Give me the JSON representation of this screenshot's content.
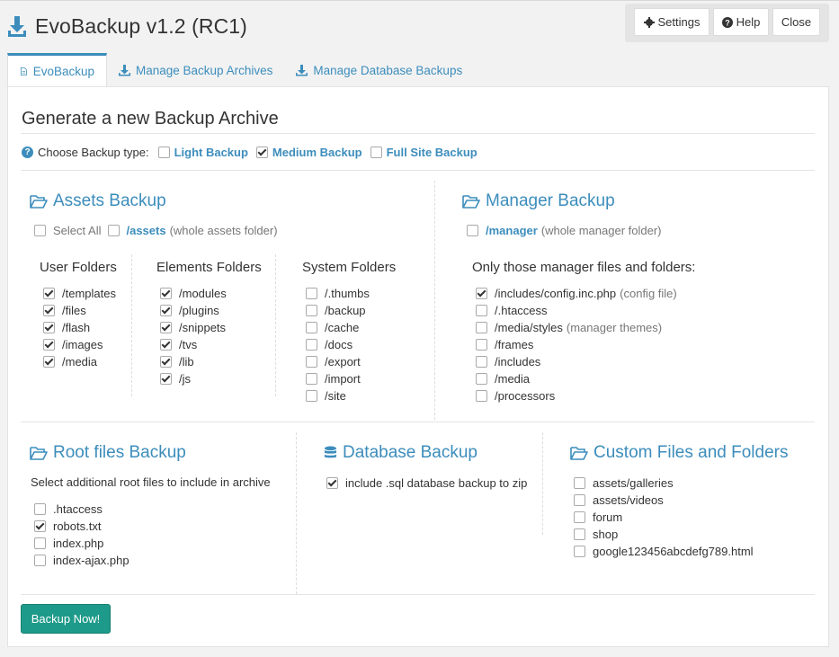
{
  "header": {
    "title": "EvoBackup v1.2 (RC1)",
    "settings_label": "Settings",
    "help_label": "Help",
    "close_label": "Close"
  },
  "tabs": [
    {
      "label": "EvoBackup",
      "icon": "file-icon",
      "active": true
    },
    {
      "label": "Manage Backup Archives",
      "icon": "download-icon",
      "active": false
    },
    {
      "label": "Manage Database Backups",
      "icon": "download-icon",
      "active": false
    }
  ],
  "main": {
    "heading": "Generate a new Backup Archive",
    "backup_type": {
      "label": "Choose Backup type:",
      "options": [
        {
          "label": "Light Backup",
          "checked": false
        },
        {
          "label": "Medium Backup",
          "checked": true
        },
        {
          "label": "Full Site Backup",
          "checked": false
        }
      ]
    },
    "assets": {
      "title": "Assets Backup",
      "select_all": "Select All",
      "whole_folder": "/assets",
      "whole_folder_note": "(whole assets folder)",
      "columns": [
        {
          "title": "User Folders",
          "items": [
            {
              "label": "/templates",
              "checked": true
            },
            {
              "label": "/files",
              "checked": true
            },
            {
              "label": "/flash",
              "checked": true
            },
            {
              "label": "/images",
              "checked": true
            },
            {
              "label": "/media",
              "checked": true
            }
          ]
        },
        {
          "title": "Elements Folders",
          "items": [
            {
              "label": "/modules",
              "checked": true
            },
            {
              "label": "/plugins",
              "checked": true
            },
            {
              "label": "/snippets",
              "checked": true
            },
            {
              "label": "/tvs",
              "checked": true
            },
            {
              "label": "/lib",
              "checked": true
            },
            {
              "label": "/js",
              "checked": true
            }
          ]
        },
        {
          "title": "System Folders",
          "items": [
            {
              "label": "/.thumbs",
              "checked": false
            },
            {
              "label": "/backup",
              "checked": false
            },
            {
              "label": "/cache",
              "checked": false
            },
            {
              "label": "/docs",
              "checked": false
            },
            {
              "label": "/export",
              "checked": false
            },
            {
              "label": "/import",
              "checked": false
            },
            {
              "label": "/site",
              "checked": false
            }
          ]
        }
      ]
    },
    "manager": {
      "title": "Manager Backup",
      "whole_folder": "/manager",
      "whole_folder_note": "(whole manager folder)",
      "subtitle": "Only those manager files and folders:",
      "items": [
        {
          "label": "/includes/config.inc.php",
          "note": "(config file)",
          "checked": true
        },
        {
          "label": "/.htaccess",
          "note": "",
          "checked": false
        },
        {
          "label": "/media/styles",
          "note": "(manager themes)",
          "checked": false
        },
        {
          "label": "/frames",
          "note": "",
          "checked": false
        },
        {
          "label": "/includes",
          "note": "",
          "checked": false
        },
        {
          "label": "/media",
          "note": "",
          "checked": false
        },
        {
          "label": "/processors",
          "note": "",
          "checked": false
        }
      ]
    },
    "root_files": {
      "title": "Root files Backup",
      "subtitle": "Select additional root files to include in archive",
      "items": [
        {
          "label": ".htaccess",
          "checked": false
        },
        {
          "label": "robots.txt",
          "checked": true
        },
        {
          "label": "index.php",
          "checked": false
        },
        {
          "label": "index-ajax.php",
          "checked": false
        }
      ]
    },
    "database": {
      "title": "Database Backup",
      "items": [
        {
          "label": "include .sql database backup to zip",
          "checked": true
        }
      ]
    },
    "custom": {
      "title": "Custom Files and Folders",
      "items": [
        {
          "label": "assets/galleries",
          "checked": false
        },
        {
          "label": "assets/videos",
          "checked": false
        },
        {
          "label": "forum",
          "checked": false
        },
        {
          "label": "shop",
          "checked": false
        },
        {
          "label": "google123456abcdefg789.html",
          "checked": false
        }
      ]
    },
    "backup_button": "Backup Now!"
  },
  "colors": {
    "accent": "#3c8dbc",
    "button_teal": "#1e9a8a"
  }
}
